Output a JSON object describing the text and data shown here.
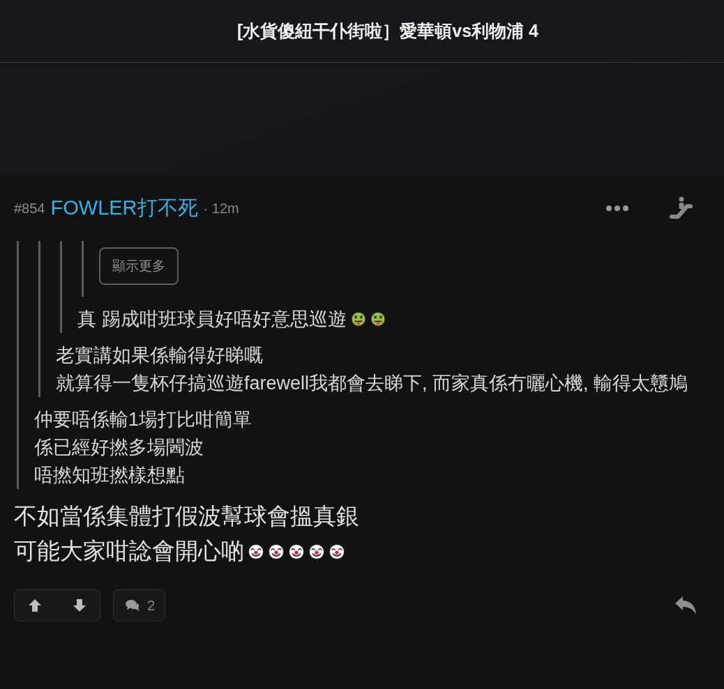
{
  "header": {
    "title": "[水貨傻紐干仆街啦］愛華頓vs利物浦 4"
  },
  "post": {
    "number": "#854",
    "author": "FOWLER打不死",
    "time": "· 12m",
    "quote": {
      "quote": {
        "quote": {
          "quote": {
            "show_more": "顯示更多"
          },
          "lines": [
            "真 踢成咁班球員好唔好意思巡遊"
          ],
          "emojis": [
            {
              "kind": "sick"
            },
            {
              "kind": "sick"
            }
          ]
        },
        "lines": [
          "老實講如果係輸得好睇嘅",
          "就算得一隻杯仔搞巡遊farewell我都會去睇下, 而家真係冇曬心機, 輸得太戇鳩"
        ]
      },
      "lines": [
        "仲要唔係輸1場打比咁簡單",
        "係已經好撚多場閪波",
        "唔撚知班撚樣想點"
      ]
    },
    "lines": [
      "不如當係集體打假波幫球會搵真銀",
      "可能大家咁諗會開心啲"
    ],
    "emojis": [
      {
        "kind": "clown"
      },
      {
        "kind": "clown"
      },
      {
        "kind": "clown"
      },
      {
        "kind": "clown"
      },
      {
        "kind": "clown"
      }
    ],
    "comment_count": "2"
  }
}
